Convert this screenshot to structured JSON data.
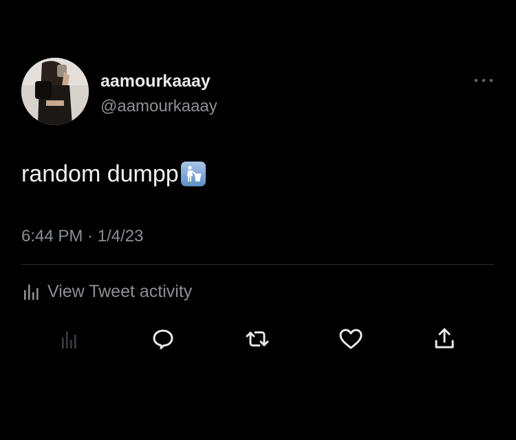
{
  "tweet": {
    "display_name": "aamourkaaay",
    "handle": "@aamourkaaay",
    "text": "random dumpp",
    "text_emoji": "wastebasket-emoji",
    "time": "6:44 PM",
    "separator": "·",
    "date": "1/4/23",
    "activity_label": "View Tweet activity"
  },
  "actions": {
    "analytics": "analytics-icon",
    "reply": "reply-icon",
    "retweet": "retweet-icon",
    "like": "like-icon",
    "share": "share-icon"
  },
  "colors": {
    "background": "#000000",
    "primary_text": "#e7e9ea",
    "secondary_text": "#8b9096",
    "divider": "#2a2d31",
    "analytics_disabled": "#3a3d42"
  }
}
